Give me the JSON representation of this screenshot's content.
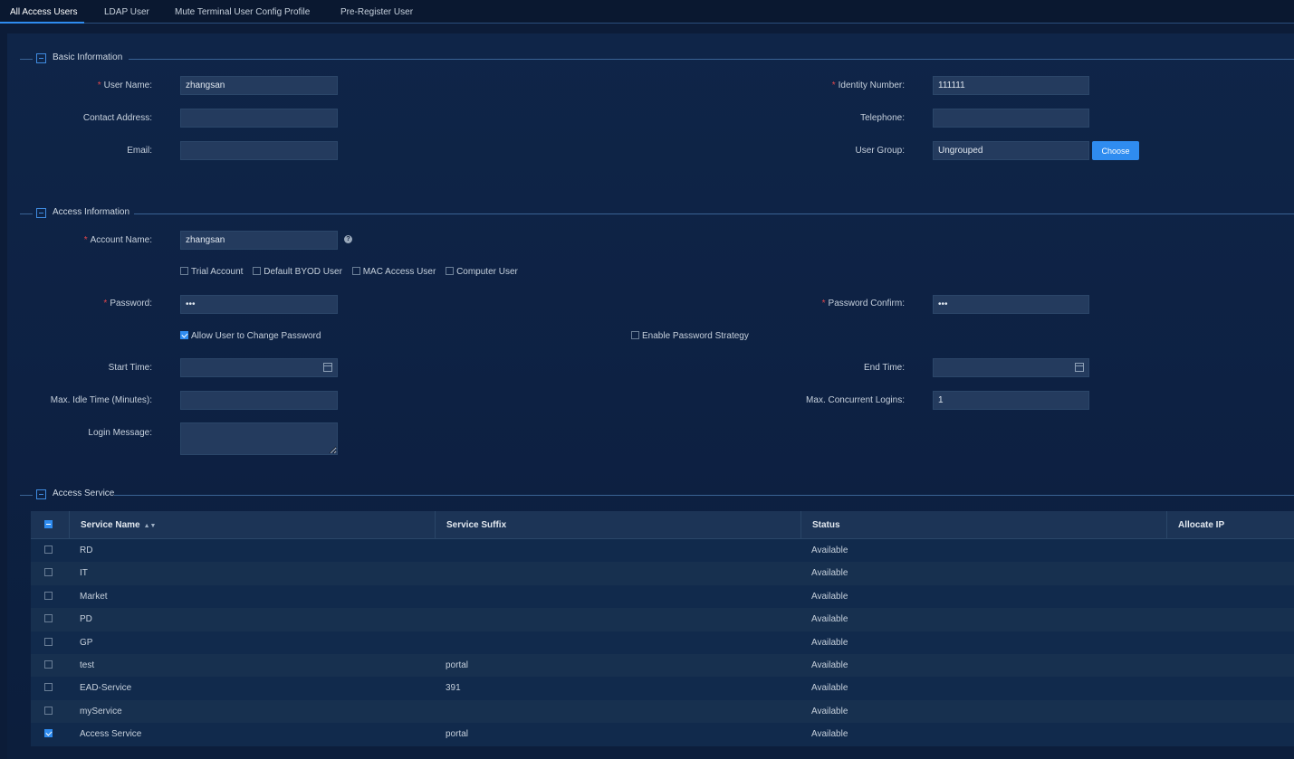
{
  "tabs": [
    {
      "label": "All Access Users",
      "active": true
    },
    {
      "label": "LDAP User",
      "active": false
    },
    {
      "label": "Mute Terminal User Config Profile",
      "active": false
    },
    {
      "label": "Pre-Register User",
      "active": false
    }
  ],
  "basic": {
    "title": "Basic Information",
    "user_name_label": "User Name:",
    "user_name_value": "zhangsan",
    "identity_label": "Identity Number:",
    "identity_value": "111111",
    "contact_label": "Contact Address:",
    "contact_value": "",
    "telephone_label": "Telephone:",
    "telephone_value": "",
    "email_label": "Email:",
    "email_value": "",
    "group_label": "User Group:",
    "group_value": "Ungrouped",
    "choose_label": "Choose"
  },
  "access": {
    "title": "Access Information",
    "account_label": "Account Name:",
    "account_value": "zhangsan",
    "help_glyph": "?",
    "options": [
      {
        "label": "Trial Account",
        "checked": false
      },
      {
        "label": "Default BYOD User",
        "checked": false
      },
      {
        "label": "MAC Access User",
        "checked": false
      },
      {
        "label": "Computer User",
        "checked": false
      }
    ],
    "password_label": "Password:",
    "password_value": "•••",
    "password_confirm_label": "Password Confirm:",
    "password_confirm_value": "•••",
    "allow_change_label": "Allow User to Change Password",
    "allow_change_checked": true,
    "enable_strategy_label": "Enable Password Strategy",
    "enable_strategy_checked": false,
    "start_time_label": "Start Time:",
    "start_time_value": "",
    "end_time_label": "End Time:",
    "end_time_value": "",
    "idle_label": "Max. Idle Time (Minutes):",
    "idle_value": "",
    "concurrent_label": "Max. Concurrent Logins:",
    "concurrent_value": "1",
    "login_msg_label": "Login Message:",
    "login_msg_value": ""
  },
  "service": {
    "title": "Access Service",
    "columns": [
      "Service Name",
      "Service Suffix",
      "Status",
      "Allocate IP"
    ],
    "rows": [
      {
        "name": "RD",
        "suffix": "",
        "status": "Available",
        "ip": "",
        "checked": false
      },
      {
        "name": "IT",
        "suffix": "",
        "status": "Available",
        "ip": "",
        "checked": false
      },
      {
        "name": "Market",
        "suffix": "",
        "status": "Available",
        "ip": "",
        "checked": false
      },
      {
        "name": "PD",
        "suffix": "",
        "status": "Available",
        "ip": "",
        "checked": false
      },
      {
        "name": "GP",
        "suffix": "",
        "status": "Available",
        "ip": "",
        "checked": false
      },
      {
        "name": "test",
        "suffix": "portal",
        "status": "Available",
        "ip": "",
        "checked": false
      },
      {
        "name": "EAD-Service",
        "suffix": "391",
        "status": "Available",
        "ip": "",
        "checked": false
      },
      {
        "name": "myService",
        "suffix": "",
        "status": "Available",
        "ip": "",
        "checked": false
      },
      {
        "name": "Access Service",
        "suffix": "portal",
        "status": "Available",
        "ip": "",
        "checked": true
      }
    ]
  },
  "colors": {
    "accent": "#2f8cf0",
    "required": "#e0464b",
    "background": "#0c1c38"
  }
}
